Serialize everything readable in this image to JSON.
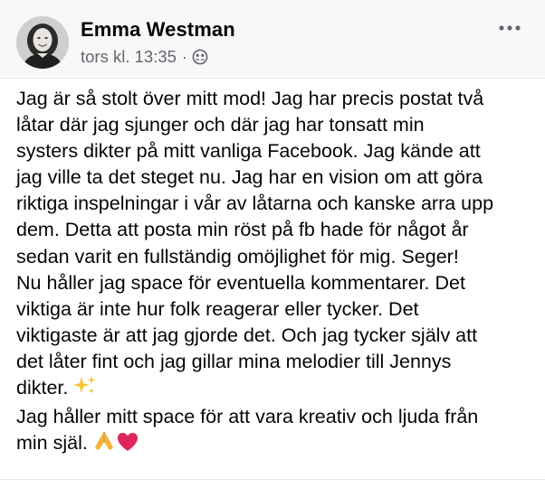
{
  "post": {
    "author_name": "Emma Westman",
    "timestamp": "tors kl. 13:35",
    "separator": "·",
    "audience_icon": "friends-icon",
    "more_icon": "more-horizontal-icon",
    "body_lines": [
      "Jag är så stolt över mitt mod! Jag har precis postat två",
      "låtar där jag sjunger och där jag har tonsatt min",
      "systers dikter på mitt vanliga Facebook. Jag kände att",
      "jag ville ta det steget nu. Jag har en vision om att göra",
      "riktiga inspelningar i vår av låtarna och kanske arra upp",
      "dem. Detta att posta min röst på fb hade för något år",
      "sedan varit en fullständig omöjlighet för mig. Seger!",
      "Nu håller jag space för eventuella kommentarer. Det",
      "viktiga är inte hur folk reagerar eller tycker. Det",
      "viktigaste är att jag gjorde det. Och jag tycker själv att",
      "det låter fint och jag gillar mina melodier till Jennys",
      "dikter.",
      "Jag håller mitt space för att vara kreativ och ljuda från",
      "min själ."
    ],
    "emojis": {
      "sparkles": "sparkles-emoji",
      "praying_hands": "folded-hands-emoji",
      "heart": "red-heart-emoji"
    },
    "colors": {
      "text": "#050505",
      "secondary_text": "#65676b",
      "header_bg": "#f7f8fa",
      "heart": "#e0245e",
      "sparkle": "#f7c531",
      "hands": "#f4b43b"
    }
  }
}
